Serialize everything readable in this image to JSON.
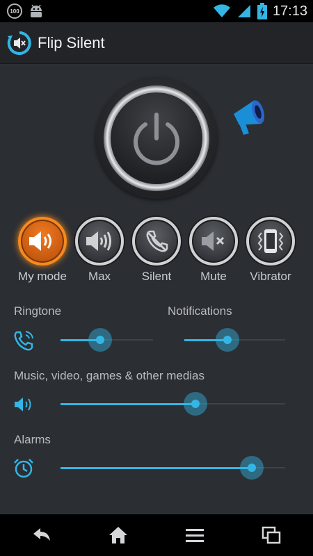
{
  "status_bar": {
    "notification_badge": "100",
    "time": "17:13",
    "icons": [
      "notification-100-icon",
      "android-icon",
      "wifi-icon",
      "signal-icon",
      "battery-charging-icon"
    ]
  },
  "app": {
    "title": "Flip Silent",
    "accent_color": "#33b5e5",
    "active_color": "#f58a1f"
  },
  "power": {
    "icon": "power-icon"
  },
  "megaphone": {
    "icon": "megaphone-icon"
  },
  "modes": [
    {
      "label": "My mode",
      "icon": "speaker-wave-icon",
      "active": true
    },
    {
      "label": "Max",
      "icon": "speaker-max-icon",
      "active": false
    },
    {
      "label": "Silent",
      "icon": "phone-crossed-icon",
      "active": false
    },
    {
      "label": "Mute",
      "icon": "speaker-mute-icon",
      "active": false
    },
    {
      "label": "Vibrator",
      "icon": "vibrate-icon",
      "active": false
    }
  ],
  "volumes": {
    "ringtone": {
      "label": "Ringtone",
      "value": 0.43,
      "icon": "phone-ring-icon"
    },
    "notifications": {
      "label": "Notifications",
      "value": 0.43
    },
    "media": {
      "label": "Music, video, games & other medias",
      "value": 0.6,
      "icon": "speaker-sound-icon"
    },
    "alarms": {
      "label": "Alarms",
      "value": 0.85,
      "icon": "alarm-clock-icon"
    }
  },
  "nav": [
    "back-icon",
    "home-icon",
    "menu-icon",
    "recent-apps-icon"
  ]
}
